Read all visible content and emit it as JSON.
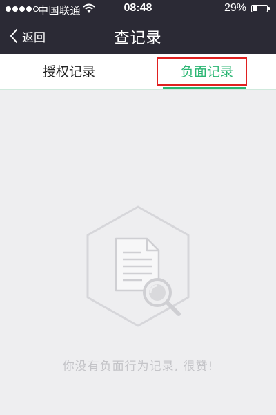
{
  "status_bar": {
    "carrier": "中国联通",
    "time": "08:48",
    "battery_percent_text": "29%",
    "battery_level": 0.29,
    "signal_bars_filled": 4,
    "signal_bars_total": 5,
    "icons": [
      "signal-icon",
      "wifi-icon",
      "battery-icon"
    ]
  },
  "nav": {
    "back_label": "返回",
    "title": "查记录",
    "back_icon": "chevron-left-icon"
  },
  "tabs": [
    {
      "label": "授权记录",
      "active": false
    },
    {
      "label": "负面记录",
      "active": true
    }
  ],
  "empty_state": {
    "icon": "document-search-icon",
    "message": "你没有负面行为记录, 很赞!"
  },
  "colors": {
    "header_bg": "#2b2a35",
    "accent": "#2bb673",
    "highlight_box": "#e02020",
    "page_bg": "#eeeef0",
    "empty_text": "#c4c4c8"
  }
}
